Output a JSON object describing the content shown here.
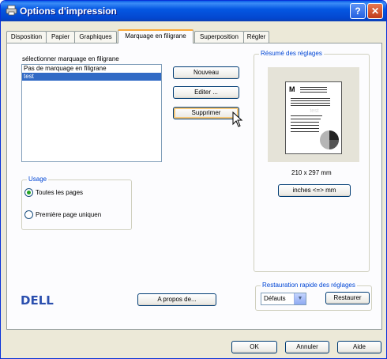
{
  "window": {
    "title": "Options d'impression",
    "help_glyph": "?",
    "close_glyph": "✕"
  },
  "tabs": [
    {
      "label": "Disposition",
      "active": false
    },
    {
      "label": "Papier",
      "active": false
    },
    {
      "label": "Graphiques",
      "active": false
    },
    {
      "label": "Marquage en filigrane",
      "active": true
    },
    {
      "label": "Superposition",
      "active": false
    },
    {
      "label": "Régler",
      "active": false
    }
  ],
  "watermark": {
    "list_label": "sélectionner marquage en filigrane",
    "items": [
      {
        "label": "Pas de marquage en filigrane",
        "selected": false
      },
      {
        "label": "test",
        "selected": true
      }
    ],
    "buttons": {
      "new": "Nouveau",
      "edit": "Editer ...",
      "delete": "Supprimer"
    }
  },
  "usage": {
    "title": "Usage",
    "options": [
      {
        "label": "Toutes les pages",
        "checked": true
      },
      {
        "label": "Première page uniquen",
        "checked": false
      }
    ]
  },
  "summary": {
    "title": "Résumé des réglages",
    "page_letter": "M",
    "watermark_preview": "test",
    "paper_size": "210 x 297 mm",
    "units_button": "inches <=> mm"
  },
  "quick_restore": {
    "title": "Restauration rapide des réglages",
    "selected": "Défauts",
    "restore_button": "Restaurer"
  },
  "brand": {
    "logo": "DELL",
    "about_button": "A propos de..."
  },
  "footer": {
    "ok": "OK",
    "cancel": "Annuler",
    "help": "Aide"
  },
  "colors": {
    "titlebar": "#0558e3",
    "selection": "#316ac5",
    "group_title": "#0046d5",
    "focus": "#f5c77a",
    "brand": "#2b4fae"
  },
  "icons": {
    "app": "printer-icon",
    "help": "help-icon",
    "close": "close-icon",
    "combo": "chevron-down-icon",
    "pointer": "mouse-cursor-icon"
  }
}
